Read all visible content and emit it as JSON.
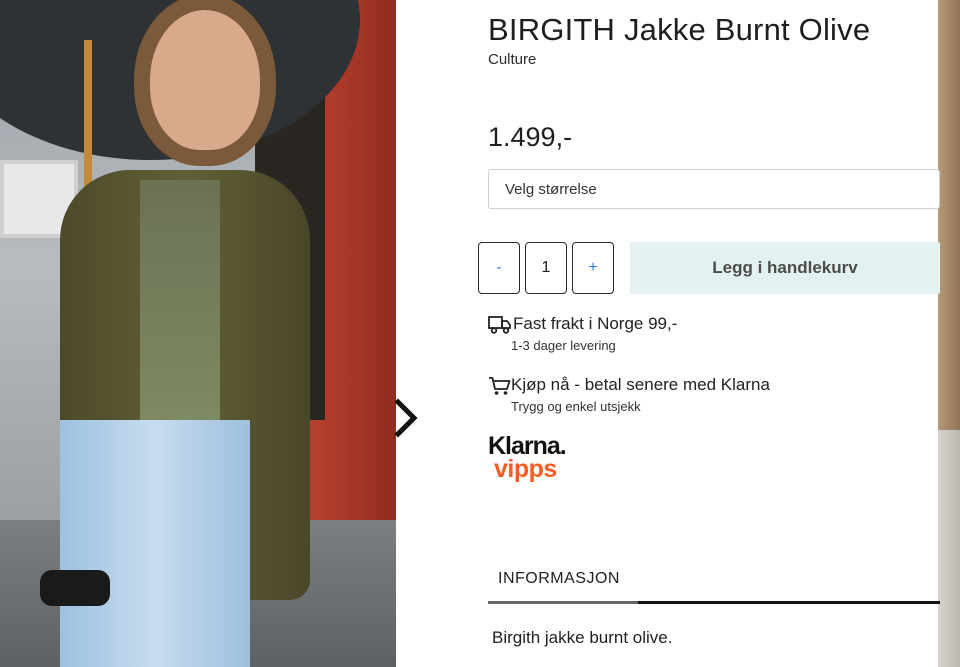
{
  "product": {
    "title": "BIRGITH Jakke Burnt Olive",
    "brand": "Culture",
    "price": "1.499,-"
  },
  "size_select": {
    "placeholder": "Velg størrelse"
  },
  "quantity": {
    "minus_label": "-",
    "value": "1",
    "plus_label": "+"
  },
  "add_to_cart": {
    "label": "Legg i handlekurv"
  },
  "shipping": {
    "icon": "truck-icon",
    "title": "Fast frakt i Norge 99,-",
    "subtitle": "1-3 dager levering"
  },
  "klarna_info": {
    "icon": "cart-icon",
    "title": "Kjøp nå - betal senere med Klarna",
    "subtitle": "Trygg og enkel utsjekk"
  },
  "payment_logos": {
    "klarna": "Klarna.",
    "vipps": "vipps"
  },
  "tabs": [
    {
      "label": "INFORMASJON",
      "active": true
    }
  ],
  "description": "Birgith jakke burnt olive.",
  "colors": {
    "add_to_cart_bg": "#e4f1f1",
    "accent_blue": "#3a7bd5",
    "vipps_orange": "#ff5b24"
  }
}
